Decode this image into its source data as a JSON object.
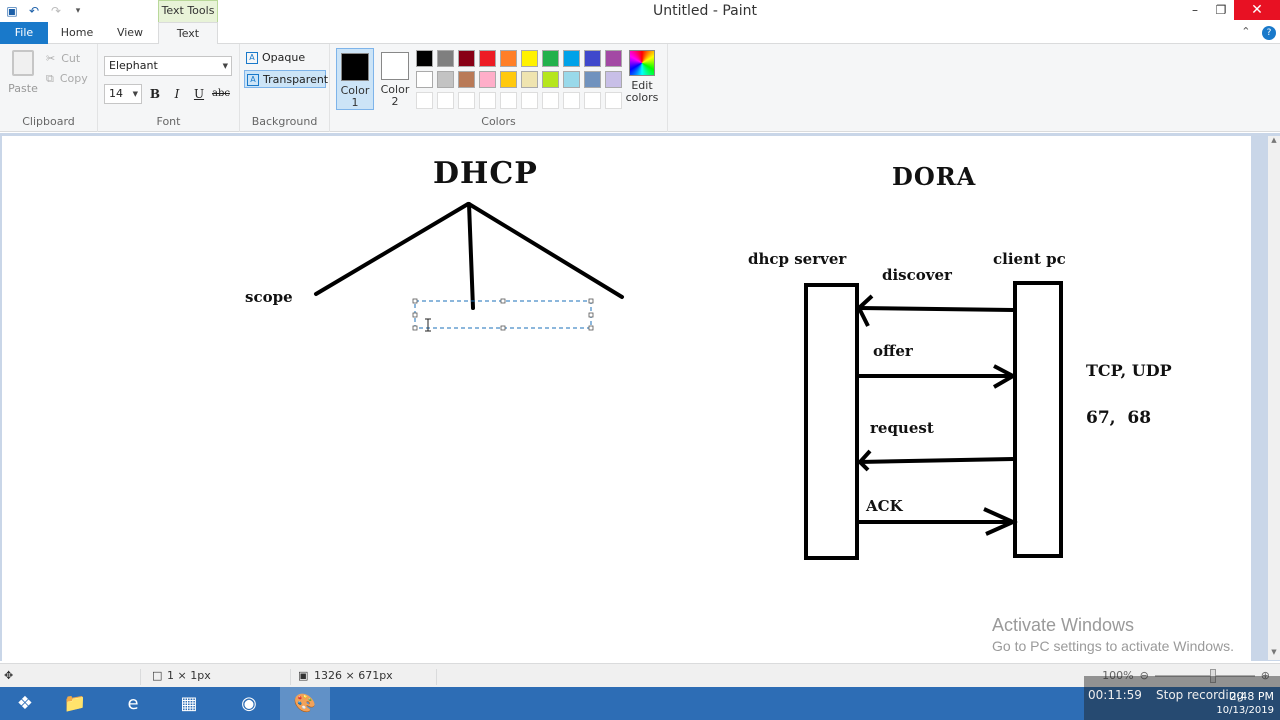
{
  "titlebar": {
    "title": "Untitled - Paint",
    "context_tab": "Text Tools",
    "qat_icons": [
      "save-icon",
      "undo-icon",
      "redo-icon",
      "customize-icon"
    ],
    "minimize": "–",
    "maximize": "❐",
    "close": "✕"
  },
  "tabs": {
    "file": "File",
    "home": "Home",
    "view": "View",
    "text": "Text"
  },
  "ribbon": {
    "clipboard": {
      "paste": "Paste",
      "cut": "Cut",
      "copy": "Copy",
      "label": "Clipboard"
    },
    "font": {
      "family": "Elephant",
      "size": "14",
      "bold": "B",
      "italic": "I",
      "underline": "U",
      "strikethrough": "abc",
      "label": "Font"
    },
    "background": {
      "opaque": "Opaque",
      "transparent": "Transparent",
      "label": "Background"
    },
    "colors": {
      "color1": "Color 1",
      "color2": "Color 2",
      "edit": "Edit colors",
      "label": "Colors",
      "color1_value": "#000000",
      "color2_value": "#ffffff",
      "palette": [
        "#000000",
        "#7f7f7f",
        "#880015",
        "#ed1c24",
        "#ff7f27",
        "#fff200",
        "#22b14c",
        "#00a2e8",
        "#3f48cc",
        "#a349a4",
        "#ffffff",
        "#c3c3c3",
        "#b97a57",
        "#ffaec9",
        "#ffc90e",
        "#efe4b0",
        "#b5e61d",
        "#99d9ea",
        "#7092be",
        "#c8bfe7"
      ]
    }
  },
  "canvas": {
    "dhcp": "DHCP",
    "scope": "scope",
    "dora": "DORA",
    "dhcp_server": "dhcp server",
    "client_pc": "client pc",
    "discover": "discover",
    "offer": "offer",
    "request": "request",
    "ack": "ACK",
    "tcp_udp": "TCP, UDP",
    "ports": "67,  68"
  },
  "status": {
    "selection": "1 × 1px",
    "size": "1326 × 671px",
    "zoom": "100%"
  },
  "overlay": {
    "activate_title": "Activate Windows",
    "activate_sub": "Go to PC settings to activate Windows.",
    "rec_time": "00:11:59",
    "rec_stop": "Stop recording",
    "clock_time": "2:48 PM",
    "clock_date": "10/13/2019"
  },
  "taskbar": {
    "items": [
      "windows-start-icon",
      "file-explorer-icon",
      "internet-explorer-icon",
      "store-icon",
      "chrome-icon",
      "paint-icon"
    ]
  }
}
